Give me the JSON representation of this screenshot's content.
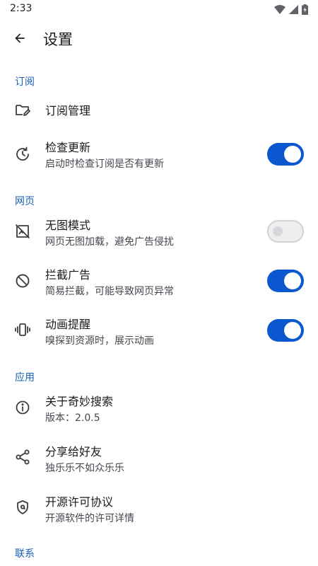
{
  "status_bar": {
    "time": "2:33"
  },
  "header": {
    "title": "设置"
  },
  "sections": {
    "subscription": {
      "title": "订阅",
      "manage": {
        "title": "订阅管理"
      },
      "check_update": {
        "title": "检查更新",
        "subtitle": "启动时检查订阅是否有更新",
        "enabled": true
      }
    },
    "webpage": {
      "title": "网页",
      "no_image": {
        "title": "无图模式",
        "subtitle": "网页无图加载，避免广告侵扰",
        "enabled": false
      },
      "block_ads": {
        "title": "拦截广告",
        "subtitle": "简易拦截，可能导致网页异常",
        "enabled": true
      },
      "animation": {
        "title": "动画提醒",
        "subtitle": "嗅探到资源时，展示动画",
        "enabled": true
      }
    },
    "app": {
      "title": "应用",
      "about": {
        "title": "关于奇妙搜索",
        "subtitle": "版本：2.0.5"
      },
      "share": {
        "title": "分享给好友",
        "subtitle": "独乐乐不如众乐乐"
      },
      "license": {
        "title": "开源许可协议",
        "subtitle": "开源软件的许可详情"
      }
    },
    "contact": {
      "title": "联系"
    }
  },
  "colors": {
    "accent": "#0b57d0",
    "section_header": "#1a5fb4",
    "switch_off_track": "#eeeeee"
  },
  "icons": {
    "back": "arrow-back-icon",
    "manage": "folder-edit-icon",
    "check_update": "update-clock-icon",
    "no_image": "image-off-icon",
    "block_ads": "block-icon",
    "animation": "vibration-icon",
    "about": "info-icon",
    "share": "share-icon",
    "license": "license-shield-icon"
  }
}
